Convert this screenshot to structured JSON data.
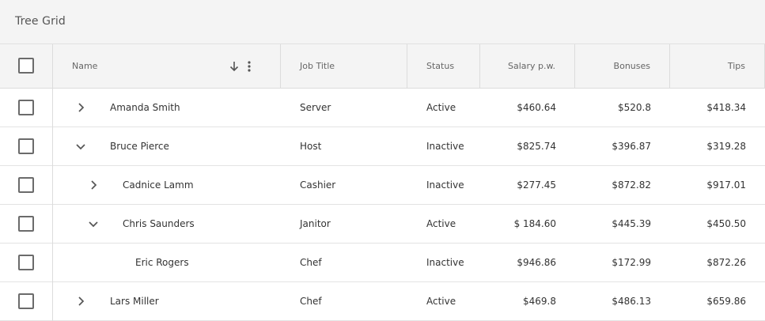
{
  "toolbar": {
    "title": "Tree Grid"
  },
  "columns": {
    "name": "Name",
    "job_title": "Job Title",
    "status": "Status",
    "salary": "Salary p.w.",
    "bonuses": "Bonuses",
    "tips": "Tips"
  },
  "rows": [
    {
      "name": "Amanda Smith",
      "job": "Server",
      "status": "Active",
      "salary": "$460.64",
      "bonuses": "$520.8",
      "tips": "$418.34",
      "expander": "collapsed",
      "level": 0
    },
    {
      "name": "Bruce Pierce",
      "job": "Host",
      "status": "Inactive",
      "salary": "$825.74",
      "bonuses": "$396.87",
      "tips": "$319.28",
      "expander": "expanded",
      "level": 0
    },
    {
      "name": "Cadnice Lamm",
      "job": "Cashier",
      "status": "Inactive",
      "salary": "$277.45",
      "bonuses": "$872.82",
      "tips": "$917.01",
      "expander": "collapsed",
      "level": 1
    },
    {
      "name": "Chris Saunders",
      "job": "Janitor",
      "status": "Active",
      "salary": "$ 184.60",
      "bonuses": "$445.39",
      "tips": "$450.50",
      "expander": "expanded",
      "level": 1
    },
    {
      "name": "Eric Rogers",
      "job": "Chef",
      "status": "Inactive",
      "salary": "$946.86",
      "bonuses": "$172.99",
      "tips": "$872.26",
      "expander": "none",
      "level": 2
    },
    {
      "name": "Lars Miller",
      "job": "Chef",
      "status": "Active",
      "salary": "$469.8",
      "bonuses": "$486.13",
      "tips": "$659.86",
      "expander": "collapsed",
      "level": 0
    }
  ],
  "icons": {
    "sort": "arrow-down-icon",
    "menu": "more-vertical-icon",
    "collapsed": "chevron-right-icon",
    "expanded": "chevron-down-icon"
  },
  "colors": {
    "header_bg": "#f4f4f4",
    "border": "#dcdcdc",
    "text": "#333333"
  }
}
